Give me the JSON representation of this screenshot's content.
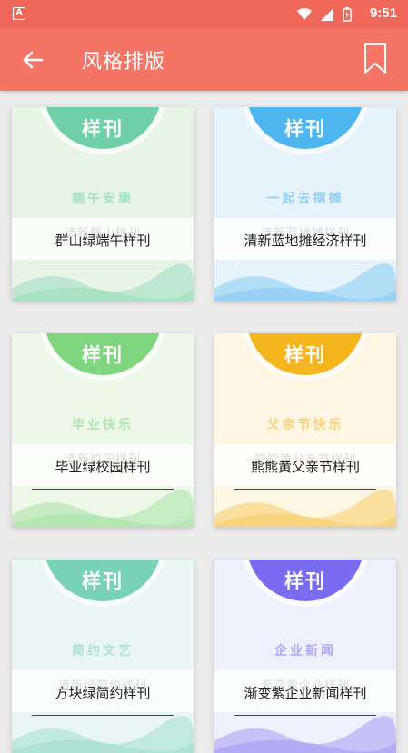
{
  "status_bar": {
    "app_badge": "A",
    "time": "9:51"
  },
  "toolbar": {
    "title": "风格排版"
  },
  "badge_label": "样刊",
  "cards": [
    {
      "name": "群山绿端午样刊",
      "subtitle": "端午安康",
      "ghost": "清新群山样刊",
      "color": "#6fd0a8",
      "accent": "#e8f5e6"
    },
    {
      "name": "清新蓝地摊经济样刊",
      "subtitle": "一起去摆摊",
      "ghost": "清新蓝地摊样刊",
      "color": "#4fb5ee",
      "accent": "#e6f3fb"
    },
    {
      "name": "毕业绿校园样刊",
      "subtitle": "毕业快乐",
      "ghost": "清新校园样刊",
      "color": "#7fd67e",
      "accent": "#eef8e8"
    },
    {
      "name": "熊熊黄父亲节样刊",
      "subtitle": "父亲节快乐",
      "ghost": "熊熊黄父亲节样刊",
      "color": "#f5b51f",
      "accent": "#fdf6e3"
    },
    {
      "name": "方块绿简约样刊",
      "subtitle": "简约文艺",
      "ghost": "清新绿简约样刊",
      "color": "#79d2b8",
      "accent": "#e9f6f3"
    },
    {
      "name": "渐变紫企业新闻样刊",
      "subtitle": "企业新闻",
      "ghost": "渐变紫企业样刊",
      "color": "#7a6cf0",
      "accent": "#eef0fb"
    }
  ]
}
